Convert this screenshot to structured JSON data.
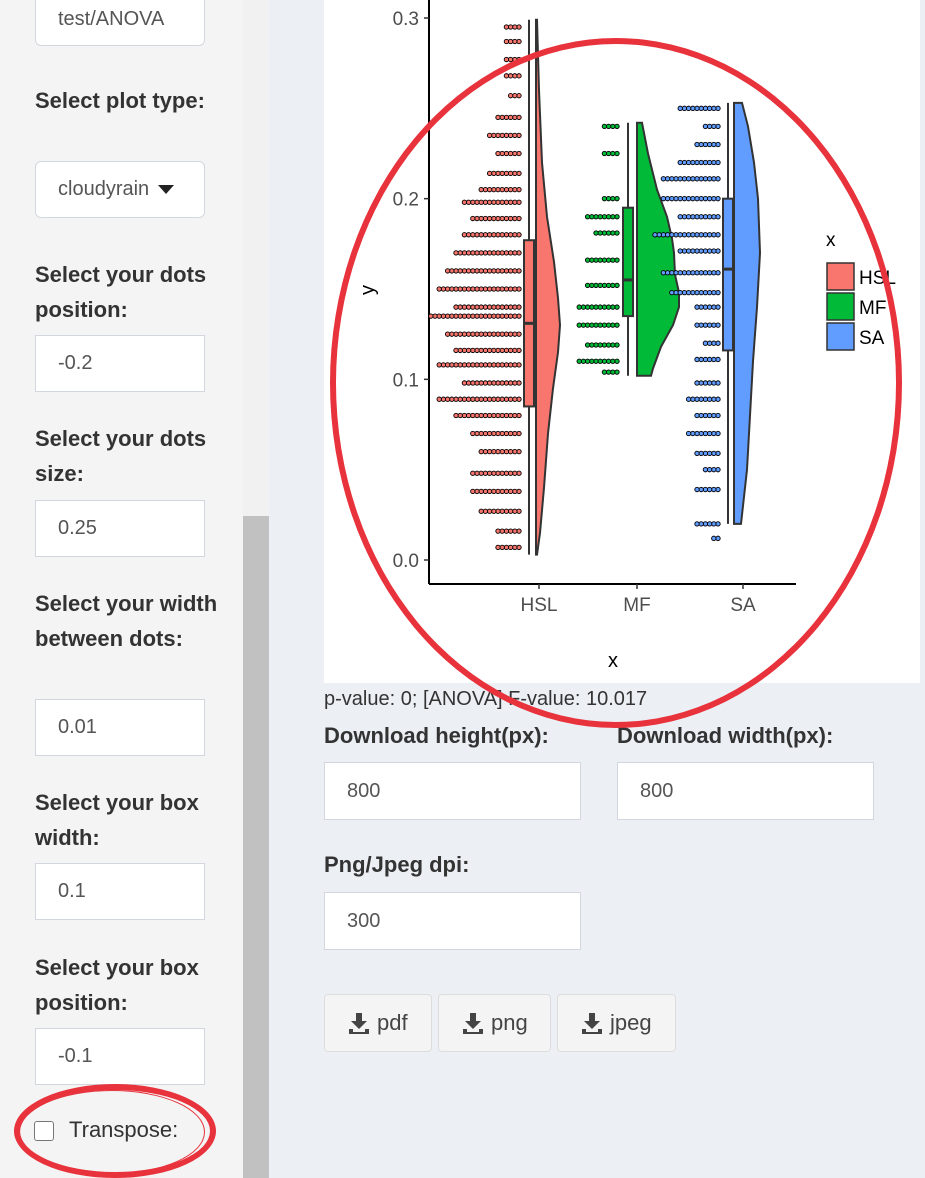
{
  "sidebar": {
    "top_input_value": "test/ANOVA",
    "plot_type_label": "Select plot type:",
    "plot_type_value": "cloudyrain",
    "dots_position_label": "Select your dots position:",
    "dots_position_value": "-0.2",
    "dots_size_label": "Select your dots size:",
    "dots_size_value": "0.25",
    "width_between_label": "Select your width between dots:",
    "width_between_value": "0.01",
    "box_width_label": "Select your box width:",
    "box_width_value": "0.1",
    "box_position_label": "Select your box position:",
    "box_position_value": "-0.1",
    "transpose_label": "Transpose:",
    "transpose_checked": false
  },
  "main": {
    "stats_text": "p-value: 0; [ANOVA] F-value: 10.017",
    "download_height_label": "Download height(px):",
    "download_height_value": "800",
    "download_width_label": "Download width(px):",
    "download_width_value": "800",
    "dpi_label": "Png/Jpeg dpi:",
    "dpi_value": "300",
    "buttons": [
      {
        "label": "pdf",
        "icon": "download-icon"
      },
      {
        "label": "png",
        "icon": "download-icon"
      },
      {
        "label": "jpeg",
        "icon": "download-icon"
      }
    ]
  },
  "annotation_color": "#e8323c",
  "chart_data": {
    "type": "raincloud",
    "xlabel": "x",
    "ylabel": "y",
    "categories": [
      "HSL",
      "MF",
      "SA"
    ],
    "colors": {
      "HSL": "#f8766d",
      "MF": "#00ba38",
      "SA": "#619cff"
    },
    "ylim": [
      0.0,
      0.3
    ],
    "yticks": [
      "0.0",
      "0.1",
      "0.2",
      "0.3"
    ],
    "legend": {
      "title": "x",
      "entries": [
        "HSL",
        "MF",
        "SA"
      ],
      "position": "right"
    },
    "boxplots": [
      {
        "name": "HSL",
        "min": 0.003,
        "q1": 0.085,
        "median": 0.131,
        "q3": 0.177,
        "max": 0.299
      },
      {
        "name": "MF",
        "min": 0.102,
        "q1": 0.135,
        "median": 0.155,
        "q3": 0.195,
        "max": 0.242
      },
      {
        "name": "SA",
        "min": 0.02,
        "q1": 0.116,
        "median": 0.161,
        "q3": 0.2,
        "max": 0.253
      }
    ],
    "dot_groups": [
      {
        "name": "HSL",
        "rows": [
          [
            0.295,
            4
          ],
          [
            0.287,
            4
          ],
          [
            0.277,
            4
          ],
          [
            0.268,
            4
          ],
          [
            0.257,
            3
          ],
          [
            0.245,
            6
          ],
          [
            0.235,
            8
          ],
          [
            0.225,
            6
          ],
          [
            0.214,
            8
          ],
          [
            0.205,
            10
          ],
          [
            0.198,
            14
          ],
          [
            0.189,
            12
          ],
          [
            0.18,
            14
          ],
          [
            0.17,
            16
          ],
          [
            0.16,
            18
          ],
          [
            0.15,
            20
          ],
          [
            0.14,
            16
          ],
          [
            0.135,
            22
          ],
          [
            0.125,
            18
          ],
          [
            0.116,
            16
          ],
          [
            0.108,
            20
          ],
          [
            0.098,
            14
          ],
          [
            0.089,
            20
          ],
          [
            0.08,
            16
          ],
          [
            0.07,
            12
          ],
          [
            0.06,
            10
          ],
          [
            0.048,
            12
          ],
          [
            0.038,
            12
          ],
          [
            0.027,
            10
          ],
          [
            0.016,
            6
          ],
          [
            0.007,
            6
          ]
        ]
      },
      {
        "name": "MF",
        "rows": [
          [
            0.24,
            4
          ],
          [
            0.225,
            4
          ],
          [
            0.2,
            4
          ],
          [
            0.19,
            8
          ],
          [
            0.181,
            6
          ],
          [
            0.166,
            8
          ],
          [
            0.152,
            8
          ],
          [
            0.14,
            10
          ],
          [
            0.13,
            10
          ],
          [
            0.119,
            8
          ],
          [
            0.11,
            10
          ],
          [
            0.104,
            4
          ]
        ]
      },
      {
        "name": "SA",
        "rows": [
          [
            0.25,
            10
          ],
          [
            0.24,
            4
          ],
          [
            0.23,
            6
          ],
          [
            0.22,
            10
          ],
          [
            0.211,
            14
          ],
          [
            0.2,
            14
          ],
          [
            0.19,
            10
          ],
          [
            0.18,
            16
          ],
          [
            0.171,
            10
          ],
          [
            0.159,
            14
          ],
          [
            0.148,
            12
          ],
          [
            0.14,
            6
          ],
          [
            0.13,
            6
          ],
          [
            0.12,
            4
          ],
          [
            0.111,
            6
          ],
          [
            0.098,
            6
          ],
          [
            0.089,
            8
          ],
          [
            0.08,
            6
          ],
          [
            0.07,
            8
          ],
          [
            0.059,
            6
          ],
          [
            0.05,
            4
          ],
          [
            0.039,
            6
          ],
          [
            0.02,
            6
          ],
          [
            0.012,
            2
          ]
        ]
      }
    ]
  }
}
